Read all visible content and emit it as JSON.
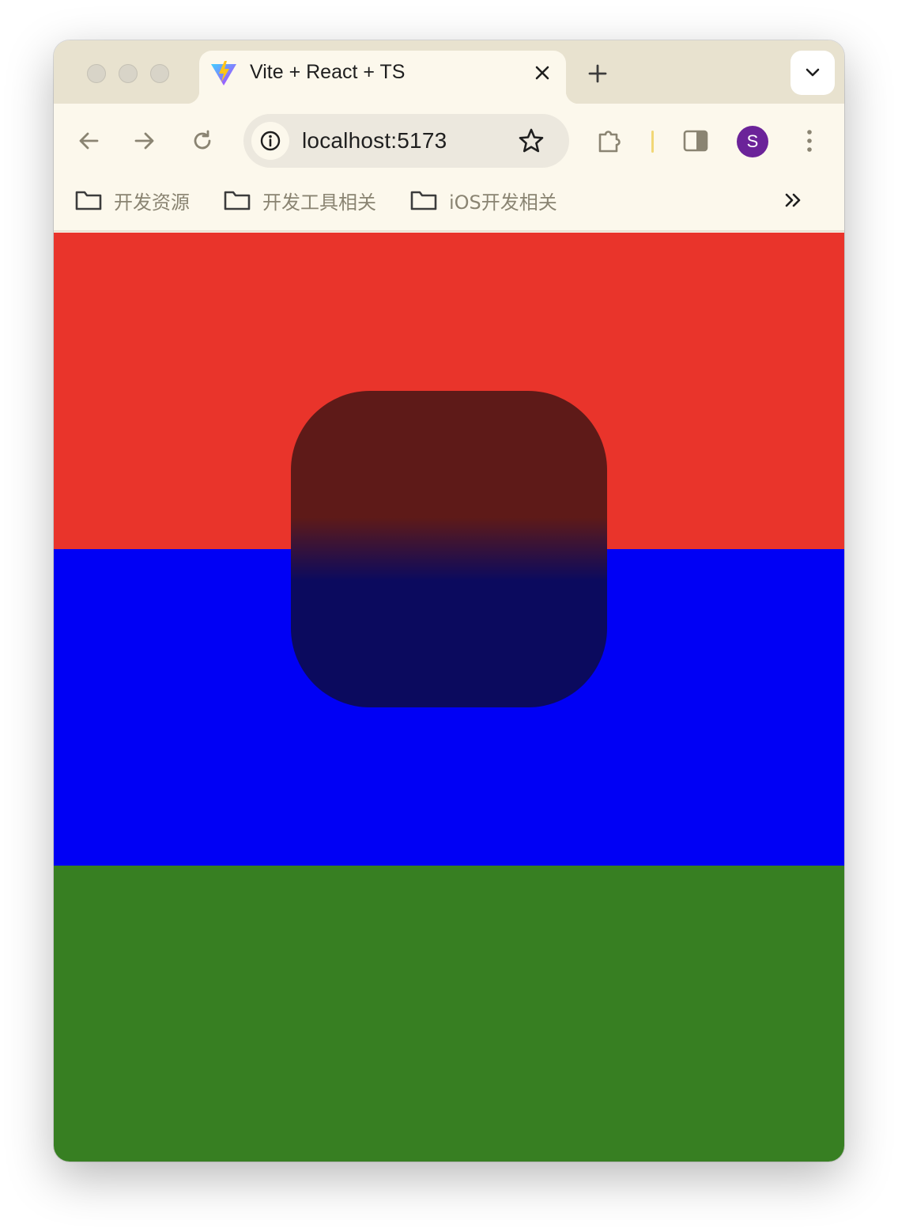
{
  "tab": {
    "title": "Vite + React + TS",
    "favicon": "vite-logo-icon"
  },
  "toolbar": {
    "url": "localhost:5173",
    "profile_initial": "S"
  },
  "bookmarks": [
    {
      "label": "开发资源",
      "icon": "folder-icon"
    },
    {
      "label": "开发工具相关",
      "icon": "folder-icon"
    },
    {
      "label": "iOS开发相关",
      "icon": "folder-icon"
    }
  ],
  "page": {
    "bands": [
      {
        "name": "red",
        "color": "#e9342b"
      },
      {
        "name": "blue",
        "color": "#0000f5"
      },
      {
        "name": "green",
        "color": "#377f22"
      }
    ],
    "overlay_gradient": [
      "#5e1a18",
      "#0b0a5e"
    ]
  }
}
